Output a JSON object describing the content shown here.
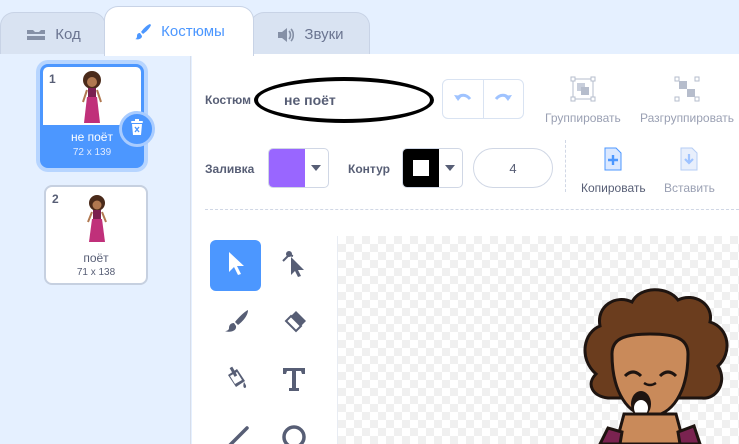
{
  "tabs": [
    {
      "label": "Код",
      "icon": "code-icon"
    },
    {
      "label": "Костюмы",
      "icon": "paintbrush-icon"
    },
    {
      "label": "Звуки",
      "icon": "speaker-icon"
    }
  ],
  "costumes": [
    {
      "number": "1",
      "name": "не поёт",
      "size": "72 x 139"
    },
    {
      "number": "2",
      "name": "поёт",
      "size": "71 x 138"
    }
  ],
  "toolbar": {
    "costume_label": "Костюм",
    "costume_name": "не поёт",
    "group_label": "Группировать",
    "ungroup_label": "Разгруппировать",
    "fill_label": "Заливка",
    "outline_label": "Контур",
    "outline_width": "4",
    "copy_label": "Копировать",
    "paste_label": "Вставить"
  },
  "colors": {
    "accent": "#4c97ff",
    "fill": "#9966ff",
    "outline": "#000000"
  },
  "tools": [
    "select-arrow-icon",
    "reshape-icon",
    "brush-icon",
    "eraser-icon",
    "fill-bucket-icon",
    "text-tool-icon",
    "line-icon",
    "circle-icon"
  ]
}
